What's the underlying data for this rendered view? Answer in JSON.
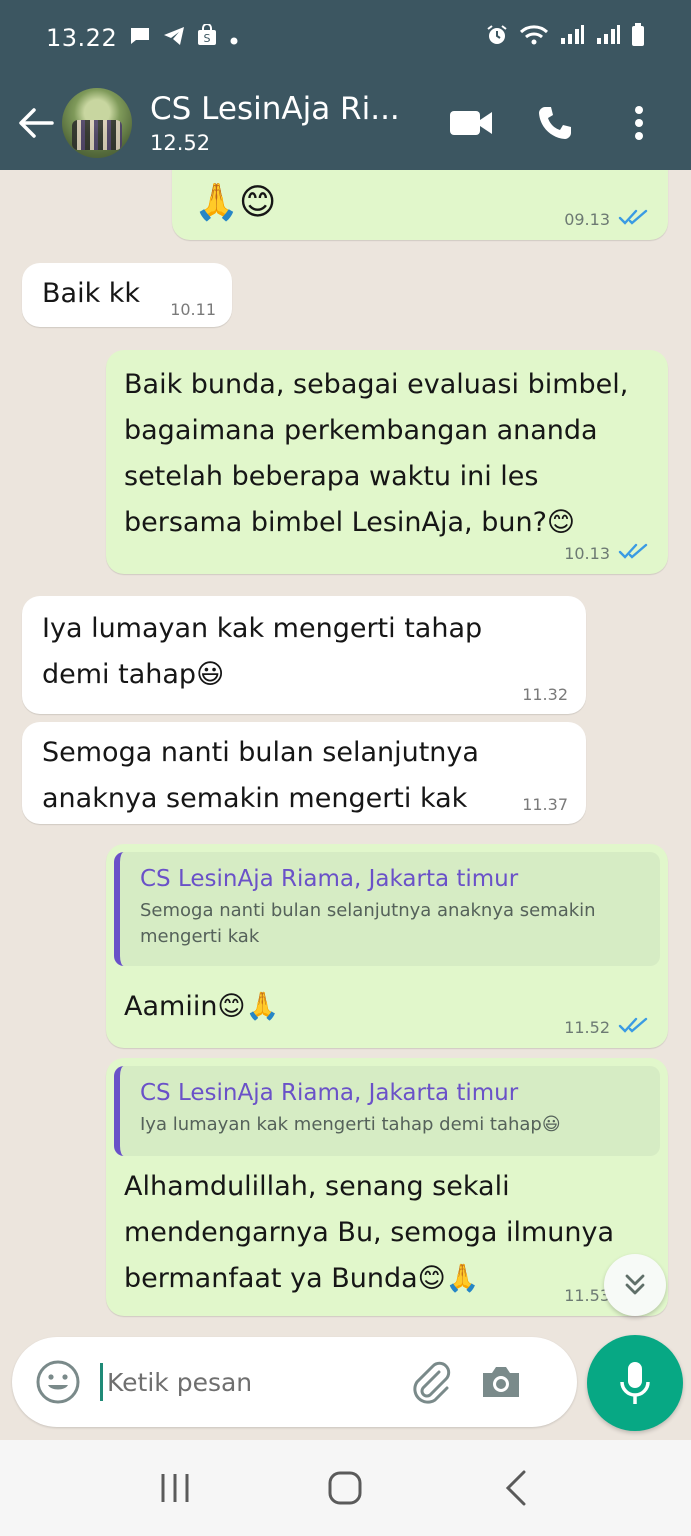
{
  "status_bar": {
    "time": "13.22",
    "indicators": [
      "message-icon",
      "telegram-icon",
      "shop-icon",
      "dot"
    ],
    "right_icons": [
      "alarm-icon",
      "wifi-icon",
      "signal-icon",
      "signal-icon",
      "battery-icon"
    ]
  },
  "header": {
    "title": "CS LesinAja Ri...",
    "subtitle": "12.52",
    "actions": [
      "video-call-icon",
      "voice-call-icon",
      "more-icon"
    ]
  },
  "messages": [
    {
      "dir": "out",
      "text": "🙏😊",
      "time": "09.13",
      "ticks": "read"
    },
    {
      "dir": "in",
      "text": "Baik kk",
      "time": "10.11"
    },
    {
      "dir": "out",
      "lines": [
        "Baik bunda, sebagai evaluasi bimbel,",
        "bagaimana perkembangan ananda",
        "setelah beberapa waktu ini les",
        "bersama bimbel LesinAja, bun?😊"
      ],
      "time": "10.13",
      "ticks": "read"
    },
    {
      "dir": "in",
      "lines": [
        "Iya lumayan kak mengerti tahap",
        "demi tahap😃"
      ],
      "time": "11.32"
    },
    {
      "dir": "in",
      "lines": [
        "Semoga nanti bulan selanjutnya",
        "anaknya semakin mengerti kak"
      ],
      "time": "11.37"
    },
    {
      "dir": "out",
      "quote": {
        "name": "CS LesinAja Riama, Jakarta timur",
        "lines": [
          "Semoga nanti bulan selanjutnya anaknya semakin",
          "mengerti kak"
        ]
      },
      "text": "Aamiin😊🙏",
      "time": "11.52",
      "ticks": "read"
    },
    {
      "dir": "out",
      "quote": {
        "name": "CS LesinAja Riama, Jakarta timur",
        "lines": [
          "Iya lumayan kak mengerti tahap demi tahap😃"
        ]
      },
      "lines": [
        "Alhamdulillah, senang sekali",
        "mendengarnya Bu, semoga ilmunya",
        "bermanfaat ya Bunda😊🙏"
      ],
      "time": "11.53",
      "ticks": "read"
    }
  ],
  "input": {
    "placeholder": "Ketik pesan"
  },
  "colors": {
    "header_bg": "#3c5661",
    "chat_bg": "#ece5dd",
    "out_bubble": "#e1f7cb",
    "in_bubble": "#ffffff",
    "read_ticks": "#3a9be3",
    "quote_accent": "#6a51c8",
    "mic_button": "#07a884"
  }
}
